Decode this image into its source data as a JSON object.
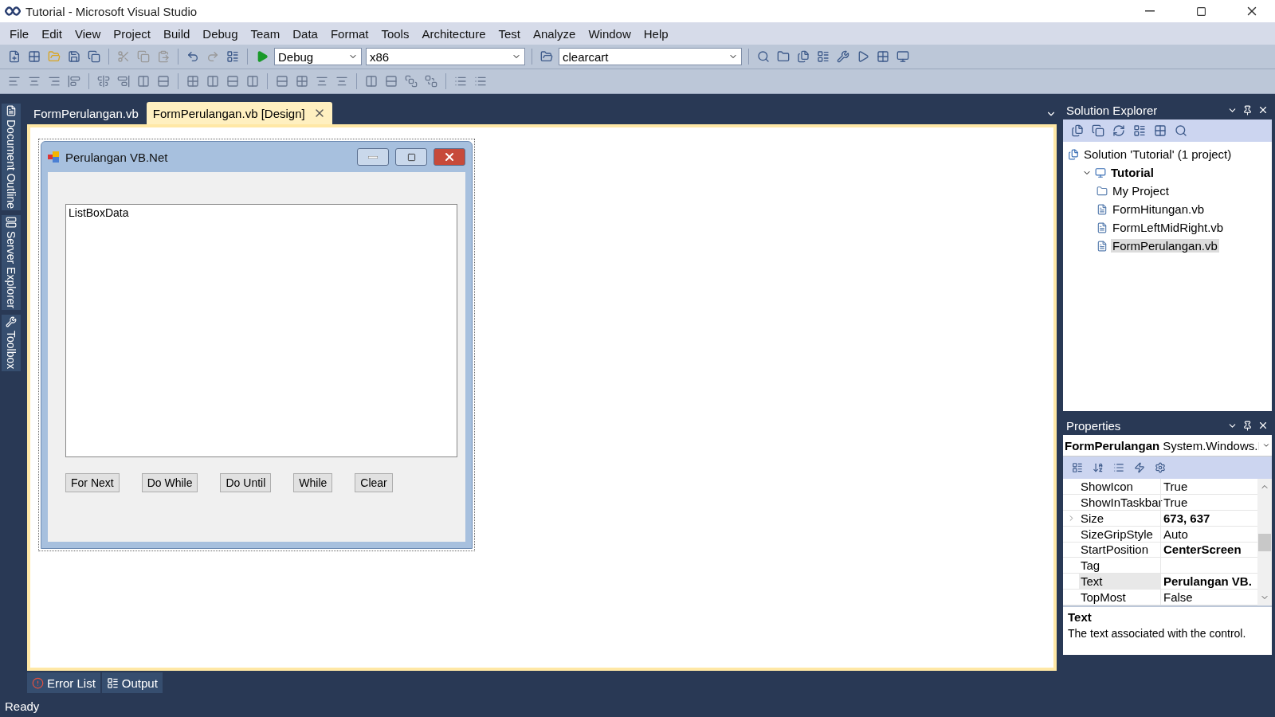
{
  "window": {
    "title": "Tutorial - Microsoft Visual Studio"
  },
  "menu": [
    "File",
    "Edit",
    "View",
    "Project",
    "Build",
    "Debug",
    "Team",
    "Data",
    "Format",
    "Tools",
    "Architecture",
    "Test",
    "Analyze",
    "Window",
    "Help"
  ],
  "toolbar": {
    "configuration": "Debug",
    "platform": "x86",
    "find": "clearcart"
  },
  "side_tabs": [
    "Document Outline",
    "Server Explorer",
    "Toolbox"
  ],
  "document_tabs": [
    {
      "label": "FormPerulangan.vb",
      "selected": false
    },
    {
      "label": "FormPerulangan.vb [Design]",
      "selected": true
    }
  ],
  "form": {
    "title": "Perulangan VB.Net",
    "listbox": "ListBoxData",
    "buttons": [
      "For Next",
      "Do While",
      "Do Until",
      "While",
      "Clear"
    ]
  },
  "solution_explorer": {
    "title": "Solution Explorer",
    "tree": [
      {
        "kind": "solution",
        "label": "Solution 'Tutorial' (1 project)",
        "selected": false,
        "children": [
          {
            "kind": "project",
            "label": "Tutorial",
            "selected": false,
            "expanded": true,
            "children": [
              {
                "kind": "folder",
                "label": "My Project",
                "selected": false
              },
              {
                "kind": "file",
                "label": "FormHitungan.vb",
                "selected": false
              },
              {
                "kind": "file",
                "label": "FormLeftMidRight.vb",
                "selected": false
              },
              {
                "kind": "file",
                "label": "FormPerulangan.vb",
                "selected": true
              }
            ]
          }
        ]
      }
    ]
  },
  "properties": {
    "title": "Properties",
    "object_name": "FormPerulangan",
    "object_type": "System.Windows.I",
    "rows": [
      {
        "name": "ShowIcon",
        "value": "True",
        "modified": false,
        "expandable": false,
        "selected": false
      },
      {
        "name": "ShowInTaskbar",
        "value": "True",
        "modified": false,
        "expandable": false,
        "selected": false
      },
      {
        "name": "Size",
        "value": "673, 637",
        "modified": true,
        "expandable": true,
        "selected": false
      },
      {
        "name": "SizeGripStyle",
        "value": "Auto",
        "modified": false,
        "expandable": false,
        "selected": false
      },
      {
        "name": "StartPosition",
        "value": "CenterScreen",
        "modified": true,
        "expandable": false,
        "selected": false
      },
      {
        "name": "Tag",
        "expandable": false,
        "selected": false
      },
      {
        "name": "Text",
        "value": "Perulangan VB.",
        "modified": true,
        "expandable": false,
        "selected": true
      },
      {
        "name": "TopMost",
        "value": "False",
        "modified": false,
        "expandable": false,
        "selected": false
      }
    ],
    "description_title": "Text",
    "description": "The text associated with the control."
  },
  "bottom_tabs": [
    "Error List",
    "Output"
  ],
  "status": "Ready"
}
